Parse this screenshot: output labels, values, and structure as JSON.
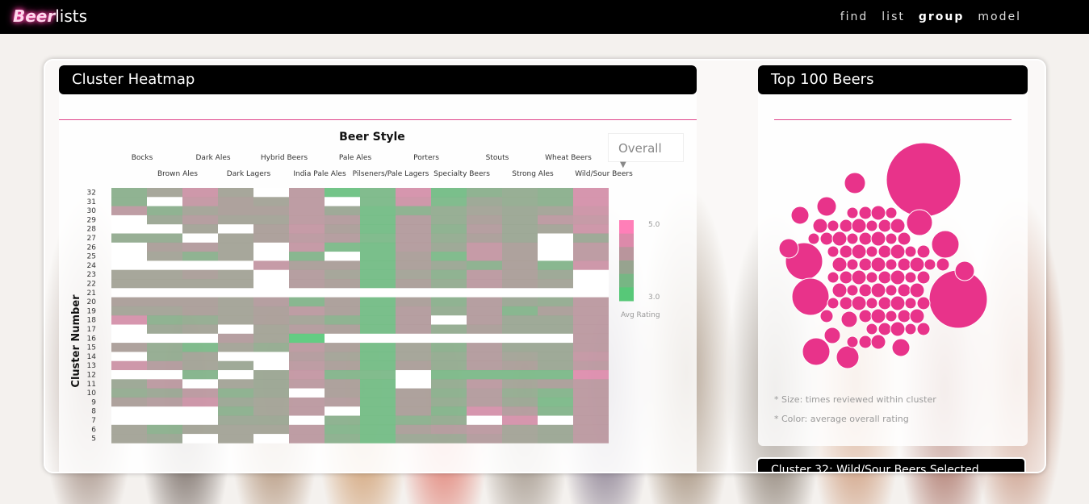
{
  "app": {
    "logo_part1": "Beer",
    "logo_part2": "lists"
  },
  "nav": [
    {
      "label": "find",
      "active": false
    },
    {
      "label": "list",
      "active": false
    },
    {
      "label": "group",
      "active": true
    },
    {
      "label": "model",
      "active": false
    }
  ],
  "heatmap_card": {
    "title": "Cluster Heatmap",
    "dropdown_value": "Overall"
  },
  "top_card": {
    "title": "Top 100 Beers",
    "note_size": "* Size: times reviewed within cluster",
    "note_color": "* Color: average overall rating"
  },
  "next_card": {
    "title": "Cluster 32: Wild/Sour Beers Selected"
  },
  "colors": {
    "pink": "#e0458a",
    "green": "#57c878",
    "grey": "#a79a95",
    "bubble": "#e8338a"
  },
  "chart_data": [
    {
      "type": "heatmap",
      "title": "Beer Style",
      "ylabel": "Cluster Number",
      "columns": [
        "Bocks",
        "Brown Ales",
        "Dark Ales",
        "Dark Lagers",
        "Hybrid Beers",
        "India Pale Ales",
        "Pale Ales",
        "Pilseners/Pale Lagers",
        "Porters",
        "Specialty Beers",
        "Stouts",
        "Strong Ales",
        "Wheat Beers",
        "Wild/Sour Beers"
      ],
      "rows": [
        32,
        31,
        30,
        29,
        28,
        27,
        26,
        25,
        24,
        23,
        22,
        21,
        20,
        19,
        18,
        17,
        16,
        15,
        14,
        13,
        12,
        11,
        10,
        9,
        8,
        7,
        6,
        5
      ],
      "legend": {
        "label": "Avg Rating",
        "max": "5.0",
        "min": "3.0"
      },
      "color_scale": [
        "#57c878",
        "#a79a95",
        "#ff7fb8"
      ],
      "values": [
        [
          3.6,
          3.9,
          4.4,
          3.9,
          null,
          4.2,
          3.2,
          3.4,
          4.5,
          3.3,
          3.6,
          3.7,
          3.6,
          4.5
        ],
        [
          3.6,
          null,
          4.3,
          4.0,
          3.9,
          4.2,
          null,
          3.4,
          4.4,
          3.4,
          3.8,
          3.7,
          3.6,
          4.5
        ],
        [
          4.2,
          3.6,
          3.9,
          4.0,
          4.0,
          4.2,
          3.8,
          3.3,
          3.6,
          3.7,
          3.9,
          3.8,
          3.9,
          4.4
        ],
        [
          null,
          3.8,
          4.1,
          3.9,
          3.9,
          4.2,
          4.1,
          3.3,
          4.1,
          3.7,
          4.0,
          3.8,
          4.2,
          4.3
        ],
        [
          null,
          null,
          3.9,
          null,
          4.0,
          4.3,
          4.0,
          3.3,
          4.1,
          3.6,
          4.1,
          3.8,
          3.9,
          4.4
        ],
        [
          3.7,
          3.7,
          null,
          3.9,
          4.0,
          4.2,
          4.1,
          3.4,
          4.1,
          3.7,
          4.0,
          3.8,
          null,
          3.8
        ],
        [
          null,
          4.0,
          4.1,
          3.9,
          null,
          4.3,
          3.4,
          3.3,
          4.1,
          3.8,
          4.3,
          4.0,
          null,
          4.2
        ],
        [
          null,
          3.9,
          3.6,
          3.9,
          null,
          3.5,
          null,
          3.3,
          4.0,
          3.4,
          4.3,
          4.0,
          null,
          4.2
        ],
        [
          null,
          null,
          null,
          null,
          4.3,
          4.0,
          4.0,
          3.3,
          4.0,
          3.8,
          3.6,
          4.0,
          3.5,
          4.4
        ],
        [
          3.9,
          3.9,
          4.0,
          3.9,
          null,
          4.1,
          3.9,
          3.3,
          3.9,
          3.6,
          4.2,
          4.0,
          3.8,
          null
        ],
        [
          3.9,
          3.9,
          3.9,
          3.9,
          null,
          4.1,
          4.0,
          3.3,
          4.0,
          3.7,
          4.2,
          4.0,
          3.9,
          null
        ],
        [
          null,
          null,
          null,
          null,
          null,
          null,
          null,
          null,
          null,
          null,
          null,
          null,
          null,
          null
        ],
        [
          4.0,
          4.0,
          4.0,
          3.9,
          4.1,
          3.5,
          4.0,
          3.3,
          4.0,
          3.6,
          4.1,
          3.8,
          3.7,
          4.2
        ],
        [
          3.9,
          3.9,
          4.0,
          3.9,
          4.0,
          4.2,
          4.0,
          3.3,
          4.1,
          3.7,
          4.1,
          3.5,
          4.0,
          4.2
        ],
        [
          4.5,
          3.6,
          3.7,
          3.9,
          4.0,
          3.9,
          3.6,
          3.3,
          4.1,
          null,
          4.1,
          3.8,
          3.8,
          4.2
        ],
        [
          null,
          3.8,
          3.9,
          null,
          3.9,
          4.1,
          4.0,
          3.3,
          4.1,
          3.7,
          4.0,
          3.8,
          3.8,
          4.2
        ],
        [
          null,
          null,
          null,
          4.1,
          3.9,
          3.0,
          null,
          null,
          null,
          null,
          null,
          null,
          null,
          4.2
        ],
        [
          4.0,
          3.7,
          3.4,
          3.9,
          3.7,
          4.2,
          4.0,
          3.3,
          3.9,
          3.6,
          4.1,
          3.8,
          3.8,
          4.2
        ],
        [
          null,
          3.7,
          3.9,
          null,
          null,
          4.1,
          3.9,
          3.3,
          3.9,
          3.7,
          4.1,
          3.9,
          3.8,
          4.3
        ],
        [
          4.4,
          4.1,
          3.9,
          3.8,
          null,
          4.2,
          4.0,
          3.3,
          4.0,
          3.7,
          4.1,
          4.0,
          3.8,
          4.2
        ],
        [
          null,
          null,
          3.5,
          null,
          3.8,
          4.3,
          3.5,
          3.4,
          null,
          3.4,
          3.4,
          3.4,
          3.4,
          4.6
        ],
        [
          3.8,
          4.2,
          null,
          3.9,
          3.8,
          4.2,
          4.0,
          3.3,
          null,
          3.7,
          4.2,
          3.9,
          4.0,
          4.2
        ],
        [
          3.7,
          3.8,
          4.2,
          3.6,
          3.8,
          null,
          4.0,
          3.3,
          4.0,
          3.6,
          4.1,
          3.7,
          3.5,
          4.2
        ],
        [
          4.0,
          4.1,
          4.4,
          3.8,
          3.9,
          4.2,
          4.1,
          3.3,
          4.0,
          3.7,
          4.1,
          3.8,
          3.4,
          4.2
        ],
        [
          null,
          null,
          null,
          3.6,
          3.9,
          4.2,
          null,
          3.3,
          4.0,
          3.5,
          4.5,
          4.1,
          3.5,
          4.2
        ],
        [
          null,
          null,
          null,
          3.8,
          3.8,
          null,
          3.6,
          3.3,
          3.6,
          3.7,
          null,
          4.5,
          null,
          4.2
        ],
        [
          3.9,
          3.6,
          3.9,
          3.9,
          3.9,
          4.2,
          3.5,
          3.3,
          4.0,
          4.1,
          4.2,
          3.9,
          3.8,
          4.2
        ],
        [
          3.9,
          3.8,
          null,
          3.9,
          null,
          4.2,
          3.6,
          3.3,
          3.8,
          3.8,
          4.1,
          3.9,
          3.8,
          4.2
        ]
      ]
    },
    {
      "type": "bubble",
      "title": "Top 100 Beers"
    }
  ]
}
